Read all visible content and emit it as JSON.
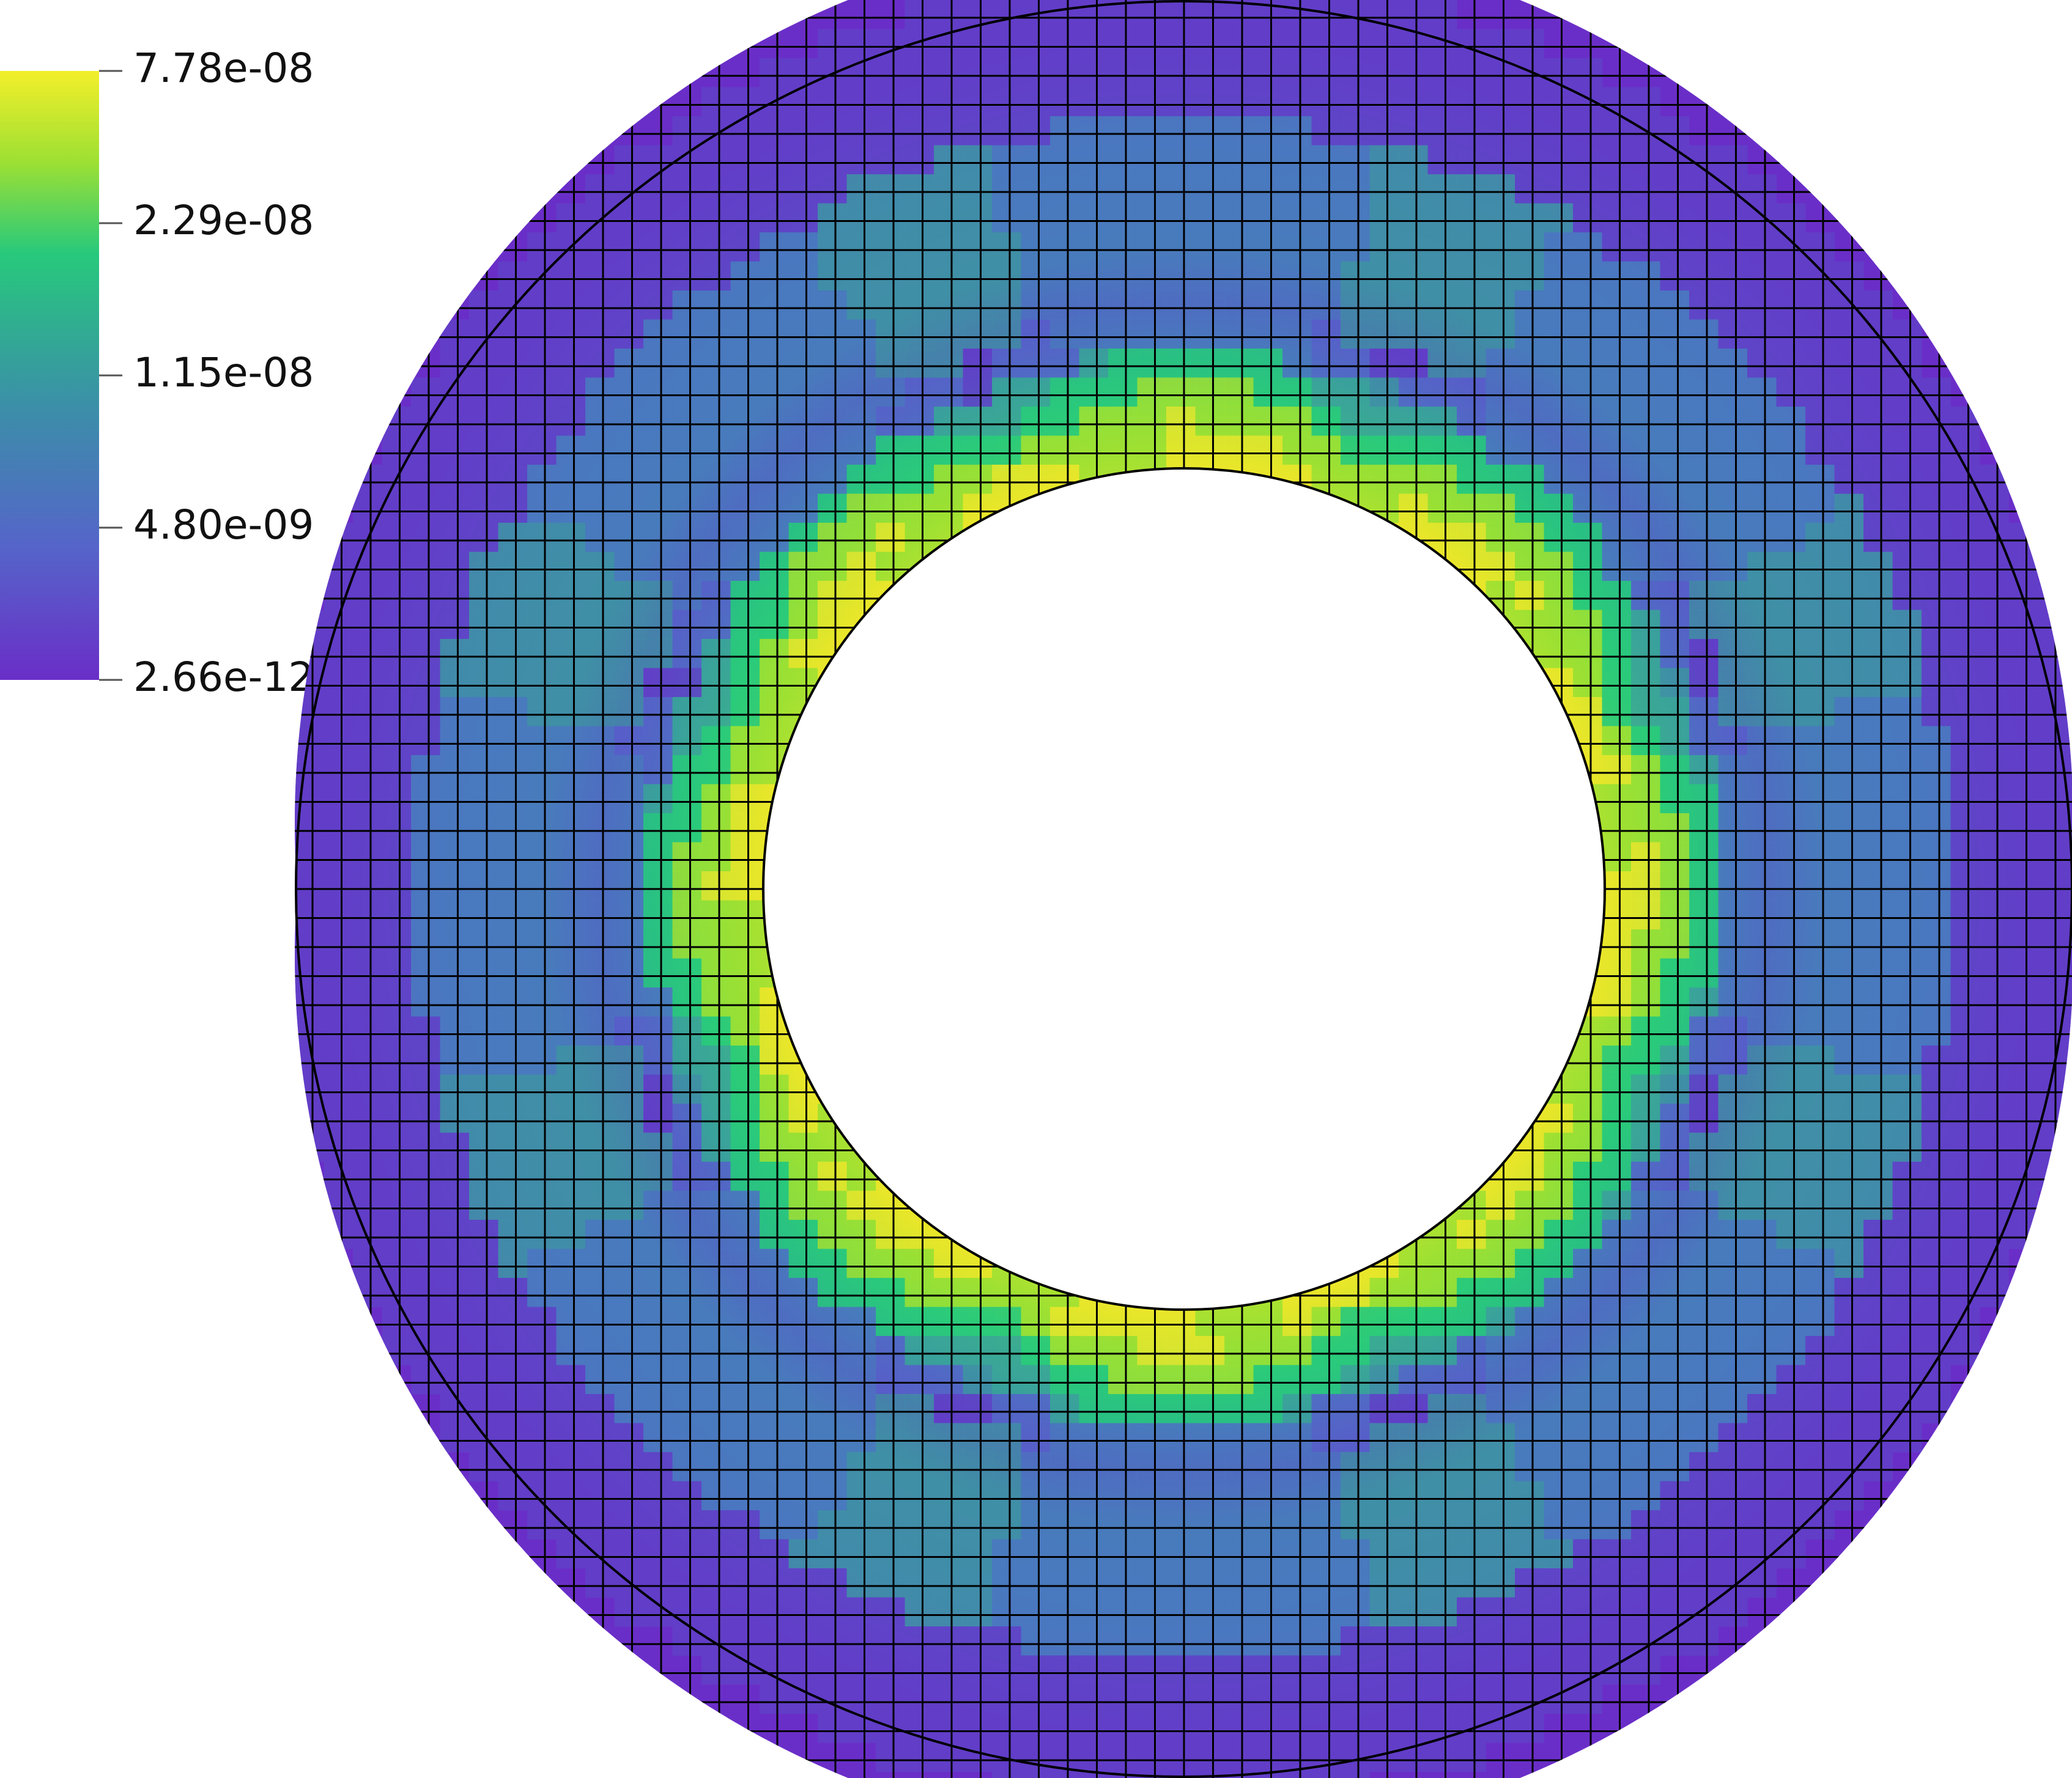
{
  "colorbar": {
    "ticks": [
      "7.78e-08",
      "2.29e-08",
      "1.15e-08",
      "4.80e-09",
      "2.66e-12"
    ],
    "max": "7.78e-08",
    "min": "2.66e-12",
    "scale": "log",
    "colormap": [
      "#440154",
      "#6a2ec8",
      "#5b62c9",
      "#3f8fa6",
      "#26b08a",
      "#3fd36b",
      "#9de033",
      "#fde725"
    ]
  },
  "mesh": {
    "shape": "annulus",
    "inner_color": "#ffffff",
    "line_color": "#000000"
  }
}
